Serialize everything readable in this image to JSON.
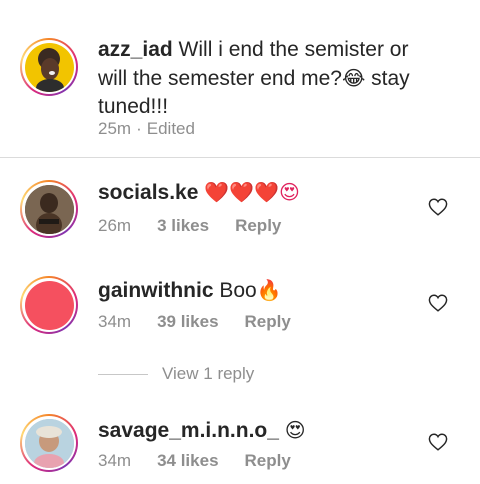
{
  "caption": {
    "username": "azz_iad",
    "text_before_emoji": "Will i end the semister or",
    "line2_start": "will the semester end me?",
    "line2_emoji": "😂",
    "line2_end": " stay",
    "line3": "tuned!!!",
    "time": "25m",
    "separator": "·",
    "edited": "Edited"
  },
  "comments": [
    {
      "username": "socials.ke",
      "text": "",
      "emoji": "❤️❤️❤️😍",
      "time": "26m",
      "likes": "3 likes",
      "reply": "Reply"
    },
    {
      "username": "gainwithnic",
      "text": "Boo",
      "emoji": "🔥",
      "time": "34m",
      "likes": "39 likes",
      "reply": "Reply",
      "avatar_color": "#f5505f"
    },
    {
      "username": "savage_m.i.n.n.o_",
      "text": "",
      "emoji": "😍",
      "time": "34m",
      "likes": "34 likes",
      "reply": "Reply"
    }
  ],
  "view_replies": "View 1 reply",
  "colors": {
    "text": "#262626",
    "secondary": "#8e8e8e",
    "divider": "#dbdbdb"
  }
}
